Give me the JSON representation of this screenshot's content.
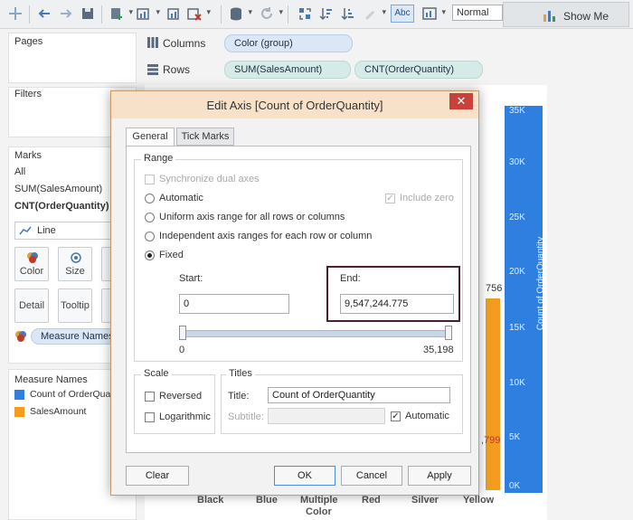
{
  "toolbar": {
    "format_label": "Abc",
    "fit_value": "Normal",
    "show_me_label": "Show Me"
  },
  "shelves": {
    "pages_label": "Pages",
    "columns_label": "Columns",
    "rows_label": "Rows",
    "columns_pills": [
      "Color (group)"
    ],
    "rows_pills": [
      "SUM(SalesAmount)",
      "CNT(OrderQuantity)"
    ]
  },
  "filters": {
    "title": "Filters"
  },
  "marks": {
    "title": "Marks",
    "items": [
      "All",
      "SUM(SalesAmount)",
      "CNT(OrderQuantity)"
    ],
    "mark_type": "Line",
    "cards": [
      "Color",
      "Size",
      "L",
      "Detail",
      "Tooltip",
      "P"
    ],
    "color_pill": "Measure Names"
  },
  "legend": {
    "title": "Measure Names",
    "entries": [
      {
        "label": "Count of OrderQuar",
        "color": "#2f7fe0"
      },
      {
        "label": "SalesAmount",
        "color": "#f39c1f"
      }
    ]
  },
  "chart": {
    "axis_title": "Count of OrderQuantity",
    "axis_ticks": [
      "35K",
      "30K",
      "25K",
      "20K",
      "15K",
      "10K",
      "5K",
      "0K"
    ],
    "x_categories": [
      "Black",
      "Blue",
      "Multiple",
      "Red",
      "Silver",
      "Yellow"
    ],
    "x_axis_title": "Color",
    "fragments": [
      "756",
      ",799"
    ],
    "bar_color": "#f39c1f",
    "axis_color": "#2f7fe0"
  },
  "dialog": {
    "title": "Edit Axis [Count of OrderQuantity]",
    "close_label": "✕",
    "tabs": [
      "General",
      "Tick Marks"
    ],
    "range": {
      "group_label": "Range",
      "synchronize": "Synchronize dual axes",
      "automatic": "Automatic",
      "include_zero": "Include zero",
      "uniform": "Uniform axis range for all rows or columns",
      "independent": "Independent axis ranges for each row or column",
      "fixed": "Fixed",
      "start_label": "Start:",
      "start_value": "0",
      "end_label": "End:",
      "end_value": "9,547,244.775",
      "slider_min": "0",
      "slider_max": "35,198"
    },
    "scale": {
      "group_label": "Scale",
      "reversed": "Reversed",
      "logarithmic": "Logarithmic"
    },
    "titles": {
      "group_label": "Titles",
      "title_label": "Title:",
      "title_value": "Count of OrderQuantity",
      "subtitle_label": "Subtitle:",
      "automatic": "Automatic"
    },
    "buttons": {
      "clear": "Clear",
      "ok": "OK",
      "cancel": "Cancel",
      "apply": "Apply"
    }
  }
}
